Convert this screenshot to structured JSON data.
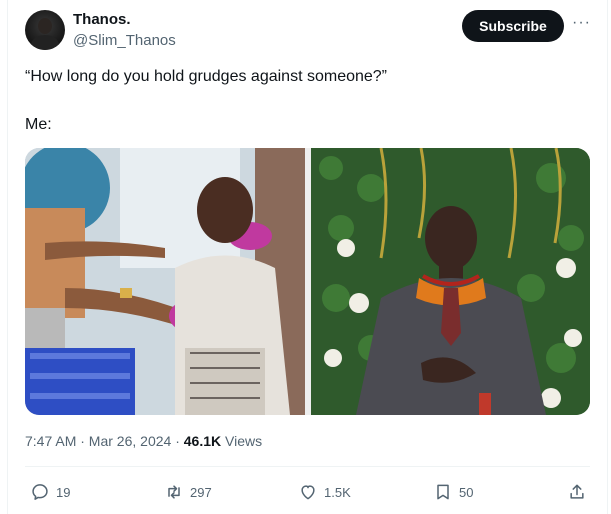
{
  "author": {
    "name": "Thanos.",
    "handle": "@Slim_Thanos"
  },
  "header": {
    "subscribe_label": "Subscribe",
    "more_label": "···"
  },
  "tweet": {
    "line1": "“How long do you hold grudges against someone?”",
    "line2": "Me:"
  },
  "meta": {
    "time_date": "7:47 AM · Mar 26, 2024 · ",
    "views_count": "46.1K",
    "views_label": " Views"
  },
  "actions": {
    "replies": "19",
    "retweets": "297",
    "likes": "1.5K",
    "bookmarks": "50"
  },
  "colors": {
    "text": "#0f1419",
    "muted": "#536471",
    "divider": "#eff3f4",
    "button": "#0f1419"
  }
}
